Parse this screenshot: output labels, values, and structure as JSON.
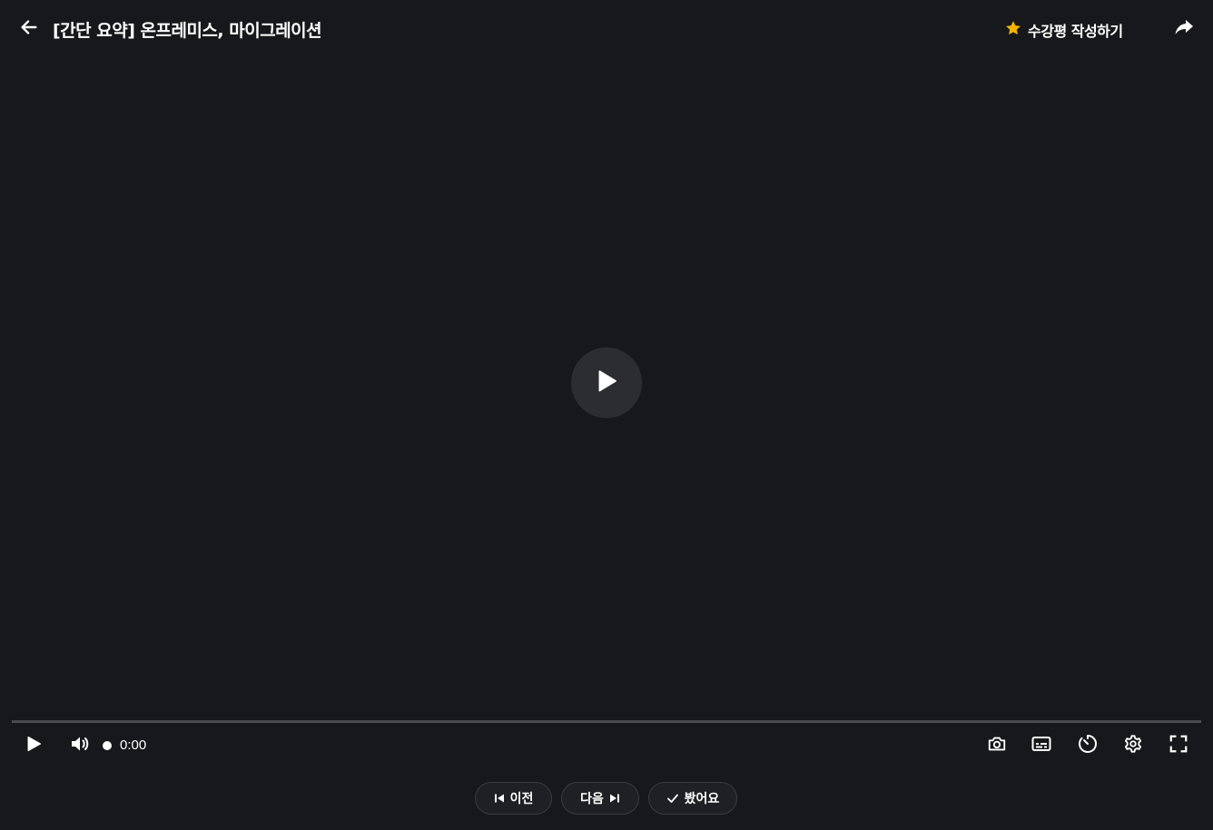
{
  "header": {
    "title": "[간단 요약] 온프레미스, 마이그레이션",
    "review_label": "수강평 작성하기",
    "icons": {
      "back": "arrow-left-icon",
      "review": "star-icon",
      "share": "share-icon"
    },
    "accent_color": "#f5b400"
  },
  "player": {
    "big_play_icon": "play-icon",
    "progress": 0,
    "time": "0:00",
    "controls": {
      "left": [
        "play-icon",
        "volume-icon"
      ],
      "right": [
        "camera-icon",
        "subtitles-icon",
        "speed-timer-icon",
        "settings-icon",
        "fullscreen-icon"
      ]
    }
  },
  "nav": {
    "prev_label": "이전",
    "next_label": "다음",
    "watched_label": "봤어요"
  },
  "colors": {
    "background": "#17181b",
    "button_bg": "#1f2024",
    "button_border": "#3a3b40",
    "progress_track": "#4a4b4f"
  }
}
